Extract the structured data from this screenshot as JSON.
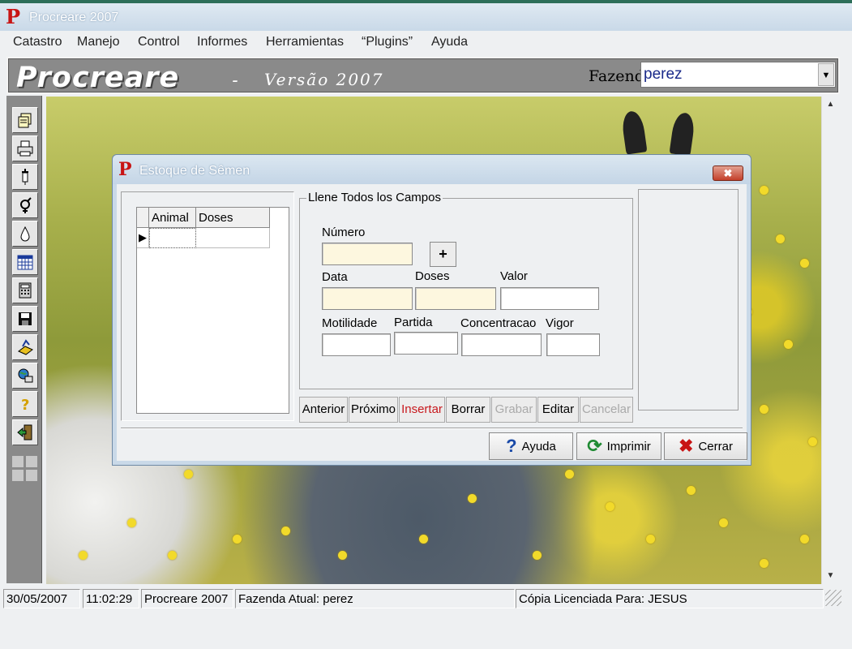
{
  "app": {
    "title": "Procreare 2007",
    "logo_letter": "P"
  },
  "menu": [
    "Catastro",
    "Manejo",
    "Control",
    "Informes",
    "Herramientas",
    "“Plugins”",
    "Ayuda"
  ],
  "banner": {
    "brand": "Procreare",
    "dash": "-",
    "version": "Versão 2007",
    "farm_label": "Fazenda",
    "farm_value": "perez"
  },
  "toolbar_icons": [
    "documents-icon",
    "printer-icon",
    "syringe-icon",
    "gender-icon",
    "drop-icon",
    "calendar-icon",
    "calculator-icon",
    "save-icon",
    "backup-icon",
    "network-icon",
    "help-icon",
    "exit-icon"
  ],
  "dialog": {
    "logo_letter": "P",
    "title": "Estoque de Sêmen",
    "close": "✖",
    "grid": {
      "columns": [
        "Animal",
        "Doses"
      ]
    },
    "form": {
      "legend": "Llene Todos los Campos",
      "labels": {
        "numero": "Número",
        "data": "Data",
        "doses": "Doses",
        "valor": "Valor",
        "motilidade": "Motilidade",
        "partida": "Partida",
        "concentracao": "Concentracao",
        "vigor": "Vigor"
      },
      "plus": "+"
    },
    "nav_buttons": {
      "anterior": "Anterior",
      "proximo": "Próximo",
      "insertar": "Insertar",
      "borrar": "Borrar",
      "grabar": "Grabar",
      "editar": "Editar",
      "cancelar": "Cancelar"
    },
    "bottom_buttons": {
      "ayuda": "Ayuda",
      "imprimir": "Imprimir",
      "cerrar": "Cerrar"
    },
    "accent_colors": {
      "insertar": "#c8191e",
      "disabled": "#aaaaaa"
    }
  },
  "statusbar": {
    "date": "30/05/2007",
    "time": "11:02:29",
    "app": "Procreare 2007",
    "farm": "Fazenda Atual: perez",
    "license": "Cópia Licenciada Para: JESUS"
  }
}
